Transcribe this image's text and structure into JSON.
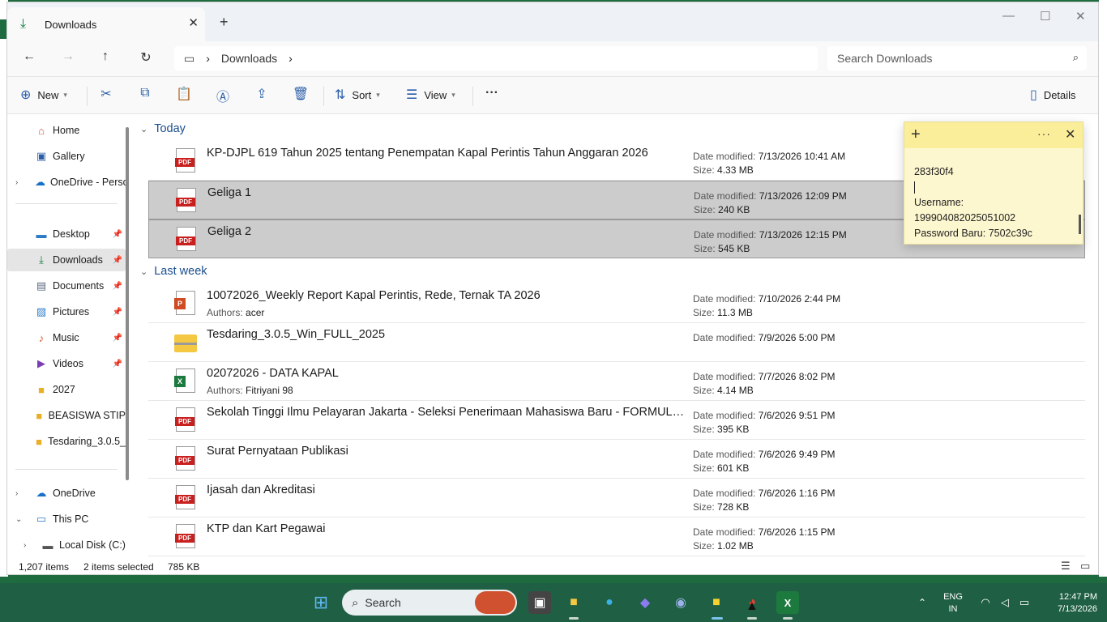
{
  "window": {
    "tab_title": "Downloads",
    "tab_icon": "download-icon",
    "controls": [
      "minimize-icon",
      "maximize-icon",
      "close-icon"
    ]
  },
  "address": {
    "crumb": "Downloads",
    "search_placeholder": "Search Downloads"
  },
  "toolbar": {
    "new_label": "New",
    "sort_label": "Sort",
    "view_label": "View",
    "details_label": "Details"
  },
  "nav": {
    "items": [
      {
        "label": "Home",
        "icon": "home-icon"
      },
      {
        "label": "Gallery",
        "icon": "gallery-icon"
      },
      {
        "label": "OneDrive - Perso",
        "icon": "cloud-icon"
      },
      {
        "label": "Desktop",
        "icon": "desktop-icon"
      },
      {
        "label": "Downloads",
        "icon": "download-icon"
      },
      {
        "label": "Documents",
        "icon": "document-icon"
      },
      {
        "label": "Pictures",
        "icon": "pictures-icon"
      },
      {
        "label": "Music",
        "icon": "music-icon"
      },
      {
        "label": "Videos",
        "icon": "videos-icon"
      },
      {
        "label": "2027",
        "icon": "folder-icon"
      },
      {
        "label": "BEASISWA STIP",
        "icon": "folder-icon"
      },
      {
        "label": "Tesdaring_3.0.5_",
        "icon": "folder-icon"
      },
      {
        "label": "OneDrive",
        "icon": "cloud-icon"
      },
      {
        "label": "This PC",
        "icon": "pc-icon"
      },
      {
        "label": "Local Disk (C:)",
        "icon": "disk-icon"
      }
    ]
  },
  "groups": {
    "today": "Today",
    "last_week": "Last week"
  },
  "labels": {
    "date_modified": "Date modified:",
    "size": "Size:",
    "authors": "Authors:"
  },
  "files": [
    {
      "name": "KP-DJPL 619 Tahun 2025 tentang Penempatan Kapal Perintis Tahun Anggaran 2026",
      "type": "pdf",
      "date": "7/13/2026 10:41 AM",
      "size": "4.33 MB",
      "author": "",
      "selected": false
    },
    {
      "name": "Geliga 1",
      "type": "pdf",
      "date": "7/13/2026 12:09 PM",
      "size": "240 KB",
      "author": "",
      "selected": true
    },
    {
      "name": "Geliga 2",
      "type": "pdf",
      "date": "7/13/2026 12:15 PM",
      "size": "545 KB",
      "author": "",
      "selected": true
    },
    {
      "name": "10072026_Weekly Report Kapal Perintis, Rede, Ternak TA 2026",
      "type": "ppt",
      "date": "7/10/2026 2:44 PM",
      "size": "11.3 MB",
      "author": "acer",
      "selected": false
    },
    {
      "name": "Tesdaring_3.0.5_Win_FULL_2025",
      "type": "zip",
      "date": "7/9/2026 5:00 PM",
      "size": "",
      "author": "",
      "selected": false
    },
    {
      "name": "02072026 - DATA KAPAL",
      "type": "xls",
      "date": "7/7/2026 8:02 PM",
      "size": "4.14 MB",
      "author": "Fitriyani 98",
      "selected": false
    },
    {
      "name": "Sekolah Tinggi Ilmu Pelayaran Jakarta - Seleksi Penerimaan Mahasiswa Baru - FORMULI...",
      "type": "pdf",
      "date": "7/6/2026 9:51 PM",
      "size": "395 KB",
      "author": "",
      "selected": false
    },
    {
      "name": "Surat Pernyataan Publikasi",
      "type": "pdf",
      "date": "7/6/2026 9:49 PM",
      "size": "601 KB",
      "author": "",
      "selected": false
    },
    {
      "name": "Ijasah dan Akreditasi",
      "type": "pdf",
      "date": "7/6/2026 1:16 PM",
      "size": "728 KB",
      "author": "",
      "selected": false
    },
    {
      "name": "KTP dan Kart Pegawai",
      "type": "pdf",
      "date": "7/6/2026 1:15 PM",
      "size": "1.02 MB",
      "author": "",
      "selected": false
    }
  ],
  "sticky": {
    "line1": "283f30f4",
    "line2": "Username:",
    "line3": "199904082025051002",
    "line4": "Password Baru: 7502c39c"
  },
  "status": {
    "items": "1,207 items",
    "selected": "2 items selected",
    "size": "785 KB"
  },
  "taskbar": {
    "search_label": "Search",
    "lang1": "ENG",
    "lang2": "IN",
    "time": "12:47 PM",
    "date": "7/13/2026"
  },
  "colors": {
    "accent": "#2a5ea8",
    "selection": "#cccccc",
    "sticky": "#fdf7cf",
    "taskbar": "#1f5f44"
  }
}
